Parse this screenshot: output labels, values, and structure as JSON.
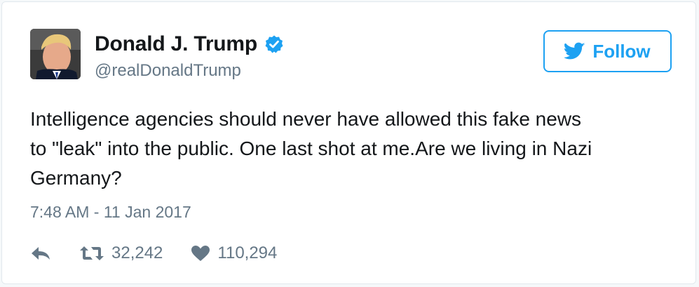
{
  "tweet": {
    "author": {
      "display_name": "Donald J. Trump",
      "handle": "@realDonaldTrump",
      "verified": true,
      "avatar_icon": "profile-photo"
    },
    "follow_button": {
      "label": "Follow",
      "icon": "twitter-bird-icon"
    },
    "text": "Intelligence agencies should never have allowed this fake news\nto \"leak\" into the public. One last shot at me.Are we living in Nazi\nGermany?",
    "timestamp": "7:48 AM - 11 Jan 2017",
    "actions": {
      "reply_icon": "reply-icon",
      "retweet_icon": "retweet-icon",
      "retweet_count": "32,242",
      "like_icon": "heart-icon",
      "like_count": "110,294"
    }
  },
  "colors": {
    "accent": "#1da1f2",
    "text": "#14171a",
    "muted": "#657786",
    "border": "#e1e8ed"
  }
}
